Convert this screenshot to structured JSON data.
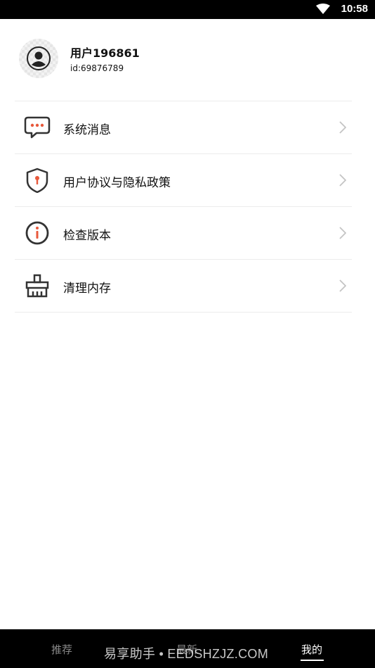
{
  "status_bar": {
    "time": "10:58",
    "wifi_icon": "wifi-icon"
  },
  "profile": {
    "username": "用户196861",
    "user_id": "id:69876789",
    "avatar_icon": "avatar-icon"
  },
  "menu": {
    "items": [
      {
        "label": "系统消息",
        "icon": "message-icon"
      },
      {
        "label": "用户协议与隐私政策",
        "icon": "shield-icon"
      },
      {
        "label": "检查版本",
        "icon": "info-icon"
      },
      {
        "label": "清理内存",
        "icon": "broom-icon"
      }
    ]
  },
  "bottom_nav": {
    "tabs": [
      {
        "label": "推荐",
        "active": false
      },
      {
        "label": "最新",
        "active": false
      },
      {
        "label": "我的",
        "active": true
      }
    ]
  },
  "watermark": "易享助手 • EEDSHZJZ.COM",
  "colors": {
    "accent": "#e8593c",
    "icon_stroke": "#333333"
  }
}
